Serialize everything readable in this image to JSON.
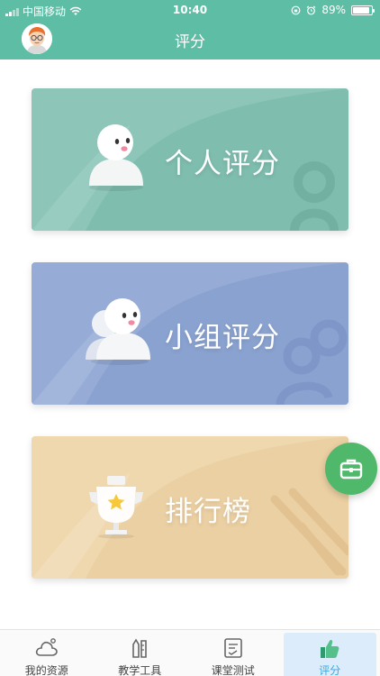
{
  "status_bar": {
    "carrier": "中国移动",
    "time": "10:40",
    "battery": "89%",
    "battery_level": 0.89
  },
  "header": {
    "title": "评分"
  },
  "cards": [
    {
      "label": "个人评分",
      "color": "#8dc5b8",
      "icon": "single-person-mascot-icon"
    },
    {
      "label": "小组评分",
      "color": "#96acd6",
      "icon": "group-mascot-icon"
    },
    {
      "label": "排行榜",
      "color": "#efd7ae",
      "icon": "trophy-icon"
    }
  ],
  "floating_button": {
    "icon": "toolbox-icon",
    "color": "#4fb86a"
  },
  "tabs": [
    {
      "label": "我的资源",
      "icon": "cloud-icon",
      "active": false
    },
    {
      "label": "教学工具",
      "icon": "tools-icon",
      "active": false
    },
    {
      "label": "课堂测试",
      "icon": "test-paper-icon",
      "active": false
    },
    {
      "label": "评分",
      "icon": "thumbs-up-icon",
      "active": true
    }
  ],
  "colors": {
    "accent": "#5dbda5",
    "active_tab": "#3fa6d8"
  }
}
